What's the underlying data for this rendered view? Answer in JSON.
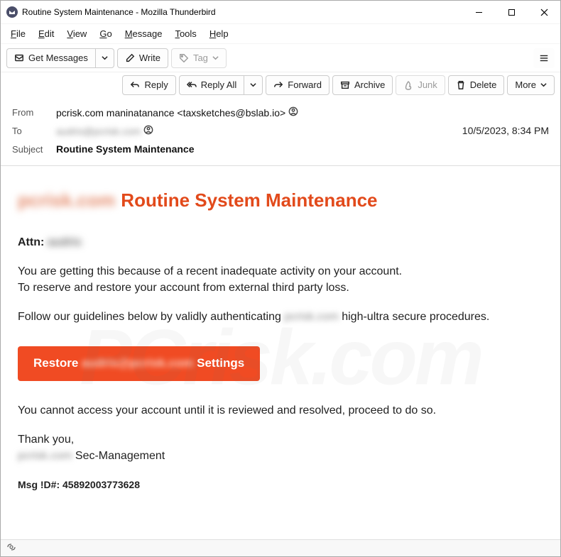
{
  "window": {
    "title": "Routine System Maintenance - Mozilla Thunderbird"
  },
  "menu": {
    "file": "File",
    "edit": "Edit",
    "view": "View",
    "go": "Go",
    "message": "Message",
    "tools": "Tools",
    "help": "Help"
  },
  "toolbar": {
    "get_messages": "Get Messages",
    "write": "Write",
    "tag": "Tag"
  },
  "actions": {
    "reply": "Reply",
    "reply_all": "Reply All",
    "forward": "Forward",
    "archive": "Archive",
    "junk": "Junk",
    "delete": "Delete",
    "more": "More"
  },
  "headers": {
    "from_label": "From",
    "to_label": "To",
    "subject_label": "Subject",
    "from_name": "pcrisk.com maninatanance",
    "from_addr": "<taxsketches@bslab.io>",
    "to_value": "audris@pcrisk.com",
    "date": "10/5/2023, 8:34 PM",
    "subject_value": "Routine System Maintenance"
  },
  "email": {
    "title_blur": "pcrisk.com",
    "title": "Routine System Maintenance",
    "attn_label": "Attn:",
    "attn_name": "audris",
    "line1": "You are getting this because of a recent inadequate activity on your account.",
    "line2": "To reserve and restore your account from external third party loss.",
    "line3a": "Follow our guidelines below by validly authenticating ",
    "line3b_blur": "pcrisk.com",
    "line3c": " high-ultra secure procedures.",
    "button_pre": "Restore",
    "button_blur": "audris@pcrisk.com",
    "button_post": "Settings",
    "line4": "You cannot access your account until it is reviewed and resolved, proceed to do so.",
    "thanks": "Thank you,",
    "sig_blur": "pcrisk.com",
    "sig": " Sec-Management",
    "msgid": "Msg !D#: 45892003773628"
  },
  "status": {
    "indicator": "((○))"
  },
  "watermark": "PCrisk.com"
}
